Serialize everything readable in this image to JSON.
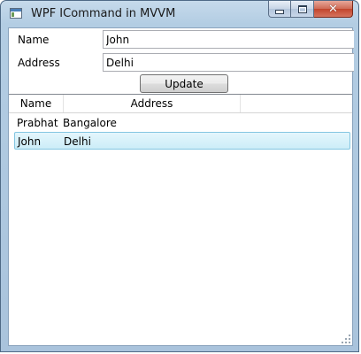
{
  "window": {
    "title": "WPF ICommand in MVVM",
    "close_glyph": "✕"
  },
  "form": {
    "name_label": "Name",
    "name_value": "John",
    "address_label": "Address",
    "address_value": "Delhi",
    "update_label": "Update"
  },
  "list": {
    "columns": [
      "Name",
      "Address"
    ],
    "rows": [
      {
        "name": "Prabhat",
        "address": "Bangalore",
        "selected": false
      },
      {
        "name": "John",
        "address": "Delhi",
        "selected": true
      }
    ]
  },
  "icons": [
    "app-icon",
    "minimize-icon",
    "maximize-icon",
    "close-icon",
    "resize-grip-icon"
  ]
}
